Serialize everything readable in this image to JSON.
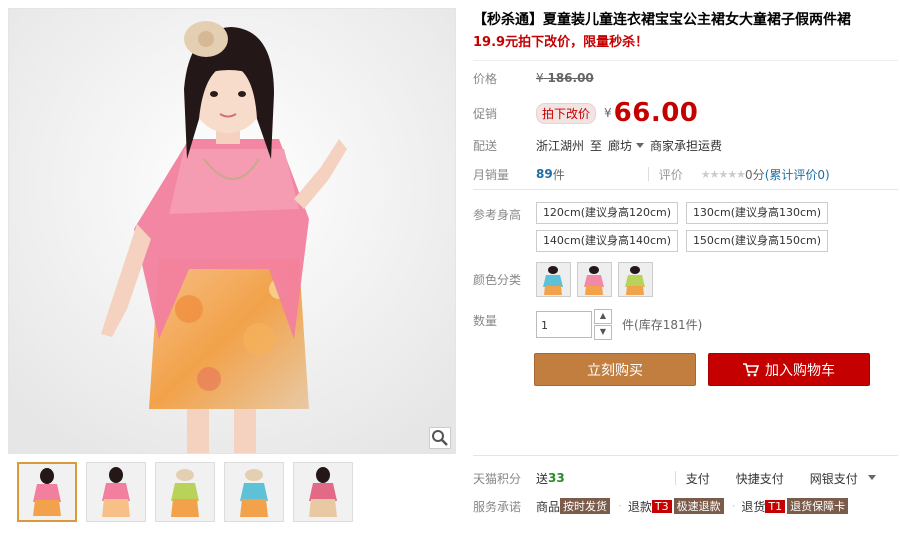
{
  "product": {
    "title": "【秒杀通】夏童装儿童连衣裙宝宝公主裙女大童裙子假两件裙",
    "subtitle": "19.9元拍下改价，限量秒杀！",
    "zoom_icon": "magnifier-icon"
  },
  "price": {
    "label": "价格",
    "currency": "¥",
    "original": "186.00"
  },
  "promo": {
    "label": "促销",
    "tag": "拍下改价",
    "currency": "¥",
    "price": "66.00"
  },
  "shipping": {
    "label": "配送",
    "from": "浙江湖州",
    "to_word": "至",
    "to": "廊坊",
    "note": "商家承担运费"
  },
  "sales": {
    "label": "月销量",
    "count": "89",
    "unit": "件",
    "review_label": "评价",
    "stars": "★★★★★",
    "score": "0分",
    "review_link": "(累计评价0)"
  },
  "sku": {
    "size_label": "参考身高",
    "sizes": [
      "120cm(建议身高120cm)",
      "130cm(建议身高130cm)",
      "140cm(建议身高140cm)",
      "150cm(建议身高150cm)"
    ],
    "color_label": "颜色分类",
    "colors": [
      "#5fc1d8",
      "#f18aa9",
      "#b9d35a"
    ]
  },
  "quantity": {
    "label": "数量",
    "value": "1",
    "up": "▲",
    "down": "▼",
    "unit": "件",
    "stock": "(库存181件)"
  },
  "buttons": {
    "buy": "立刻购买",
    "cart": "加入购物车",
    "cart_icon": "shopping-cart-icon"
  },
  "extras": {
    "points_label": "天猫积分",
    "points_prefix": "送",
    "points": "33",
    "pay1": "支付",
    "pay2": "快捷支付",
    "pay3": "网银支付",
    "service_label": "服务承诺",
    "svc1_prefix": "商品",
    "svc1_badge": "按时发货",
    "svc2_prefix": "退款",
    "svc2_code": "T3",
    "svc2_badge": "极速退款",
    "svc3_prefix": "退货",
    "svc3_code": "T1",
    "svc3_badge": "退货保障卡"
  },
  "colors": {
    "accent_red": "#c40000",
    "buy_button": "#c27e3f",
    "link_blue": "#1d6ea3"
  }
}
